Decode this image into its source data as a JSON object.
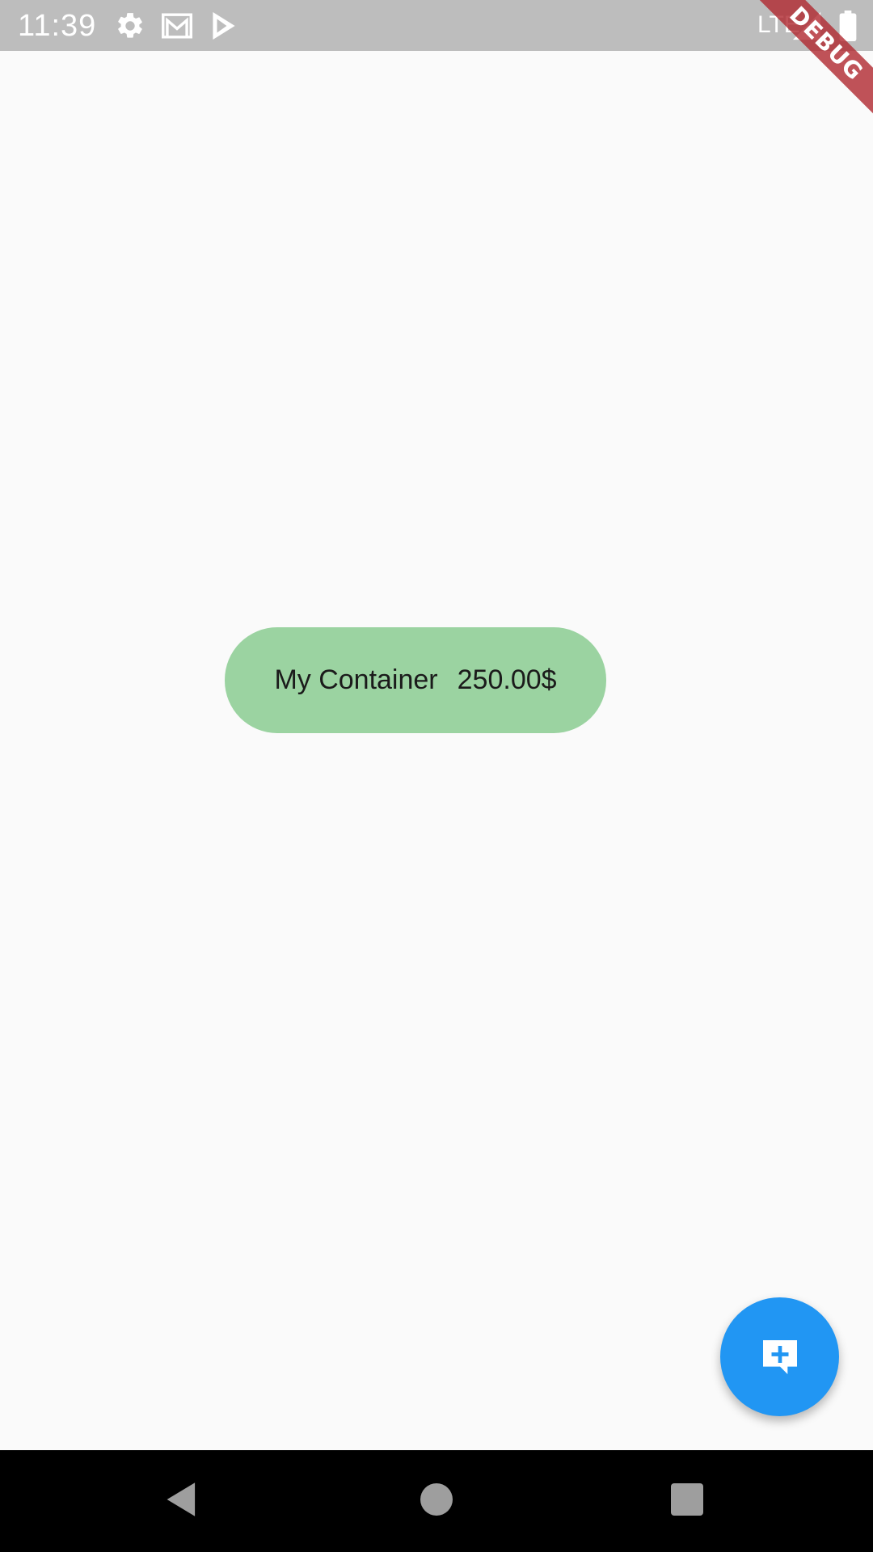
{
  "status_bar": {
    "time": "11:39",
    "network": "LTE",
    "icons": [
      "settings-icon",
      "gmail-icon",
      "play-store-icon",
      "signal-icon",
      "battery-icon"
    ]
  },
  "debug_banner": {
    "label": "DEBUG"
  },
  "container": {
    "title": "My Container",
    "amount": "250.00$",
    "background_color": "#9bd3a1"
  },
  "fab": {
    "icon": "add-comment-icon",
    "color": "#2196f3"
  },
  "navigation_bar": {
    "buttons": [
      "back-icon",
      "home-icon",
      "recents-icon"
    ]
  },
  "colors": {
    "status_bar": "#bdbdbd",
    "page_background": "#fafafa",
    "nav_bar": "#000000"
  }
}
